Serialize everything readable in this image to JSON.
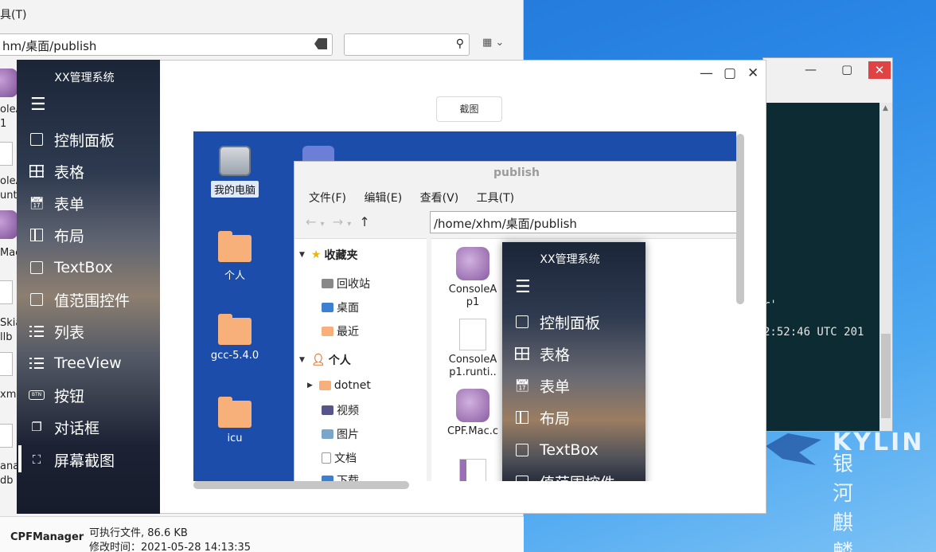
{
  "bg_fm": {
    "menu_fragment": "具(T)",
    "address": "hm/桌面/publish",
    "file_labels": [
      "oleA",
      "1",
      "oleA",
      "unti.",
      "Mac.c",
      "Skia",
      "llb",
      "xm",
      "ana",
      "db"
    ],
    "status": {
      "name": "CPFManager",
      "line1": "可执行文件, 86.6 KB",
      "line2": "修改时间：2021-05-28 14:13:35"
    }
  },
  "terminal": {
    "line1": "r'",
    "line2": "2:52:46 UTC 201"
  },
  "kylin": {
    "en": "KYLIN",
    "cn": "银河麒麟"
  },
  "sidebar": {
    "title": "XX管理系统",
    "items": [
      {
        "label": "控制面板",
        "icon": "dashboard-icon"
      },
      {
        "label": "表格",
        "icon": "grid-icon"
      },
      {
        "label": "表单",
        "icon": "form-icon"
      },
      {
        "label": "布局",
        "icon": "layout-icon"
      },
      {
        "label": "TextBox",
        "icon": "textbox-icon"
      },
      {
        "label": "值范围控件",
        "icon": "range-icon"
      },
      {
        "label": "列表",
        "icon": "list-icon"
      },
      {
        "label": "TreeView",
        "icon": "treeview-icon"
      },
      {
        "label": "按钮",
        "icon": "button-icon"
      },
      {
        "label": "对话框",
        "icon": "dialog-icon"
      },
      {
        "label": "屏幕截图",
        "icon": "crop-icon"
      }
    ],
    "active_index": 10
  },
  "main": {
    "screenshot_button": "截图",
    "desktop": {
      "icons": [
        {
          "label": "我的电脑"
        },
        {
          "label": "个人"
        },
        {
          "label": "gcc-5.4.0"
        },
        {
          "label": "icu"
        }
      ]
    },
    "inner_fm": {
      "title": "publish",
      "menu": [
        "文件(F)",
        "编辑(E)",
        "查看(V)",
        "工具(T)"
      ],
      "path": "/home/xhm/桌面/publish",
      "tree": {
        "favorites": "收藏夹",
        "fav_items": [
          "回收站",
          "桌面",
          "最近"
        ],
        "personal": "个人",
        "personal_items": [
          "dotnet",
          "视频",
          "图片",
          "文档",
          "下载"
        ]
      },
      "files": [
        {
          "line1": "ConsoleA",
          "line2": "p1"
        },
        {
          "line1": "ConsoleA",
          "line2": "p1.runti.."
        },
        {
          "line1": "CPF.Mac.c",
          "line2": ""
        }
      ]
    },
    "inner_sidebar": {
      "title": "XX管理系统",
      "items": [
        "控制面板",
        "表格",
        "表单",
        "布局",
        "TextBox",
        "值范围控件"
      ]
    }
  }
}
